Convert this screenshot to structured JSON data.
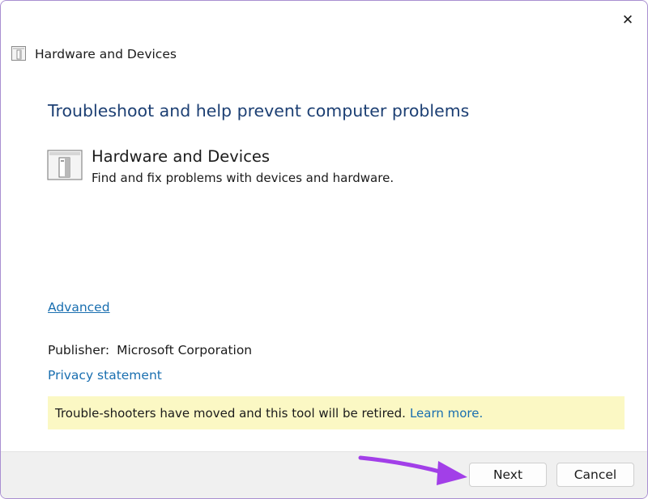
{
  "window": {
    "title": "Hardware and Devices",
    "close_glyph": "✕"
  },
  "main": {
    "heading": "Troubleshoot and help prevent computer problems",
    "tool_name": "Hardware and Devices",
    "tool_description": "Find and fix problems with devices and hardware.",
    "advanced_link": "Advanced",
    "publisher_label": "Publisher:",
    "publisher_value": "Microsoft Corporation",
    "privacy_link": "Privacy statement",
    "notice_text": "Trouble-shooters have moved and this tool will be retired.",
    "notice_link": "Learn more."
  },
  "footer": {
    "next_label": "Next",
    "cancel_label": "Cancel"
  },
  "colors": {
    "heading": "#1c3f73",
    "link": "#1a6fb0",
    "notice_bg": "#fbf8c4",
    "annotation_arrow": "#a23fe8"
  },
  "icons": {
    "title_icon": "troubleshooter-icon",
    "tool_icon": "hardware-devices-icon",
    "annotation": "purple-arrow-annotation"
  }
}
